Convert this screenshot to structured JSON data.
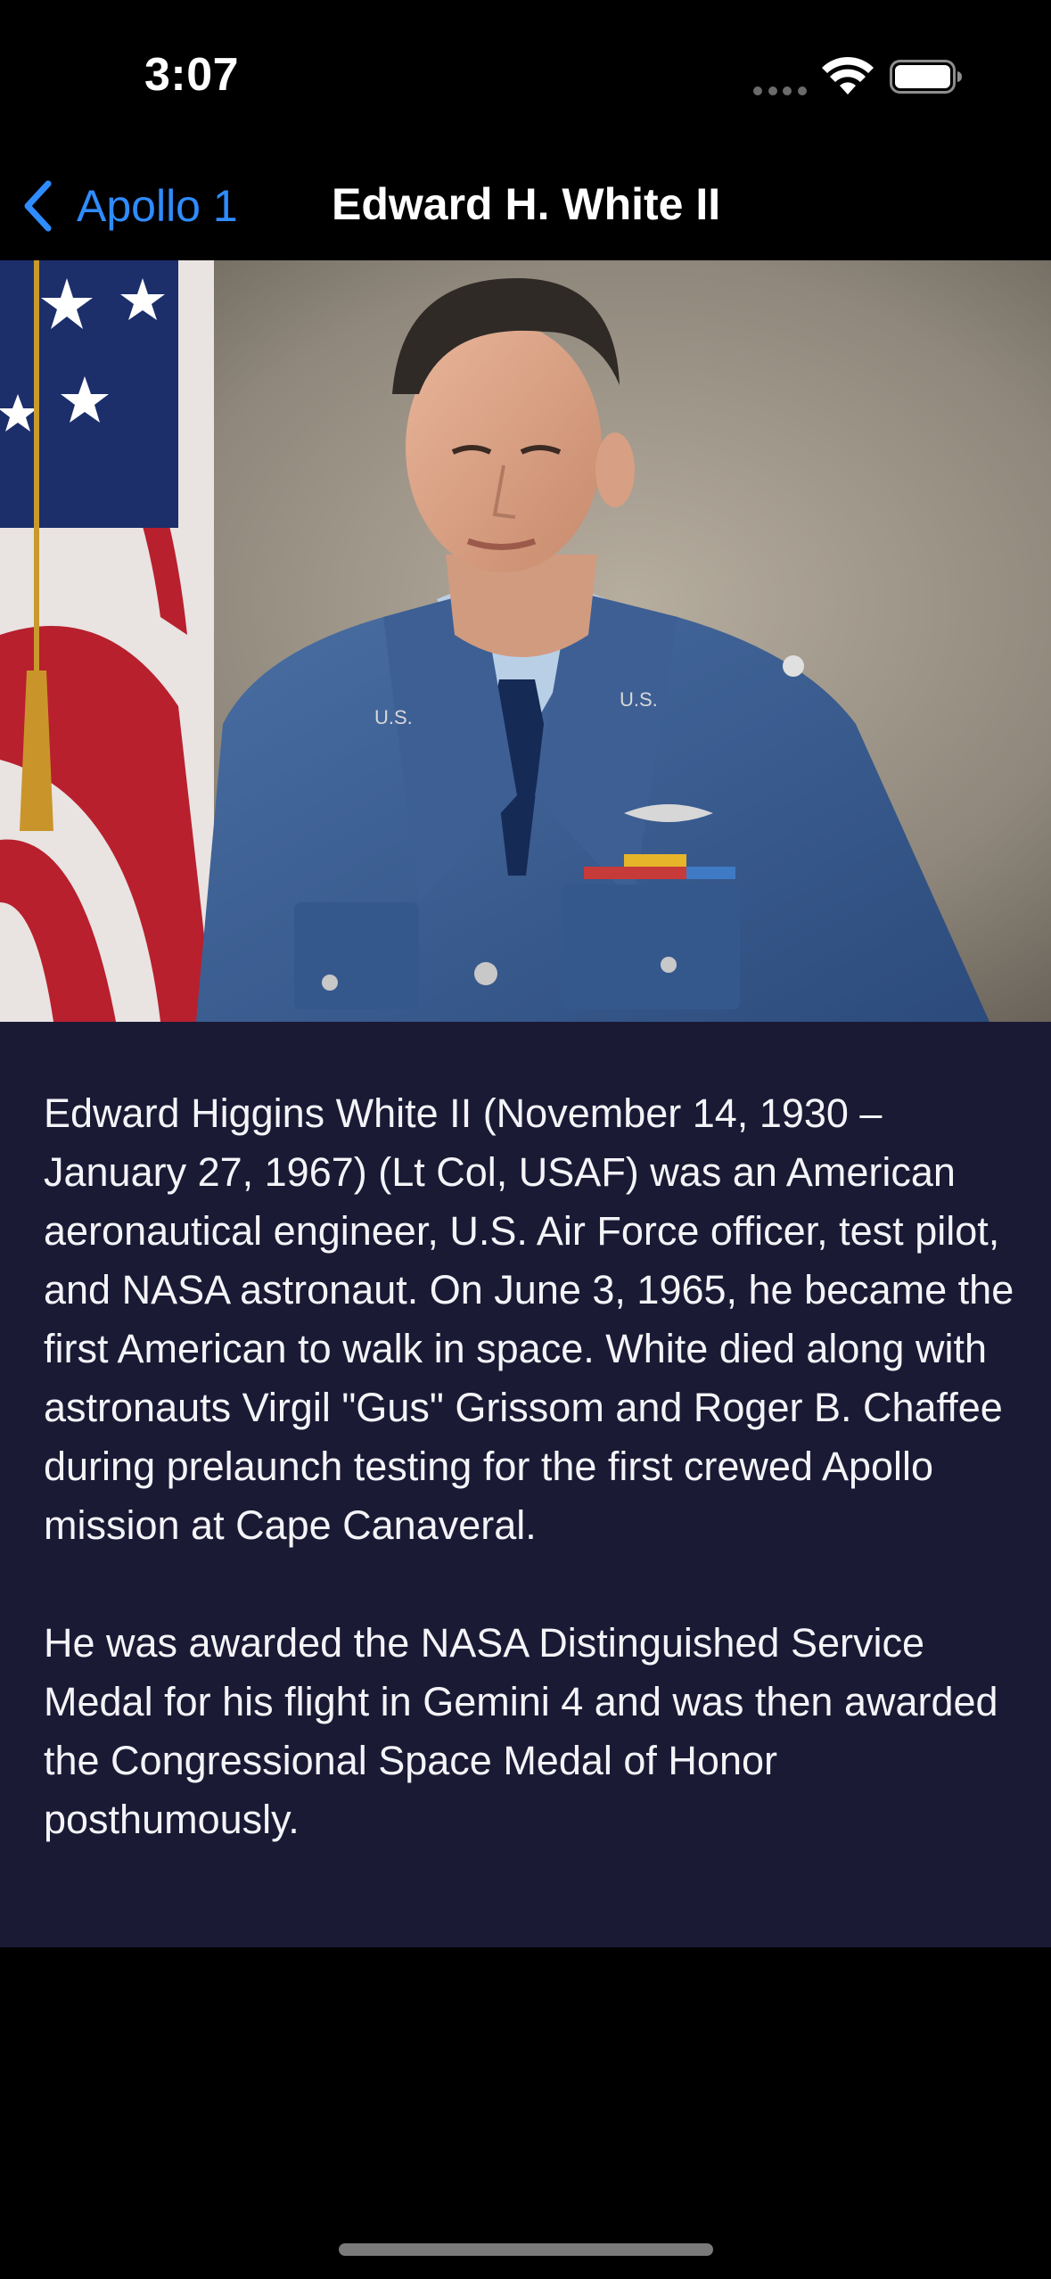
{
  "status_bar": {
    "time": "3:07",
    "icons": [
      "cellular-signal-icon",
      "wifi-icon",
      "battery-icon"
    ]
  },
  "nav_bar": {
    "back_label": "Apollo 1",
    "title": "Edward H. White II",
    "accent_color": "#2f8cff"
  },
  "photo": {
    "alt": "Edward H. White II"
  },
  "bio": {
    "paragraphs": [
      "Edward Higgins White II (November 14, 1930 – January 27, 1967) (Lt Col, USAF) was an American aeronautical engineer, U.S. Air Force officer, test pilot, and NASA astronaut. On June 3, 1965, he became the first American to walk in space. White died along with astronauts Virgil \"Gus\" Grissom and Roger B. Chaffee during prelaunch testing for the first crewed Apollo mission at Cape Canaveral.",
      "He was awarded the NASA Distinguished Service Medal for his flight in Gemini 4 and was then awarded the Congressional Space Medal of Honor posthumously."
    ],
    "background_color": "#1b1a35"
  }
}
